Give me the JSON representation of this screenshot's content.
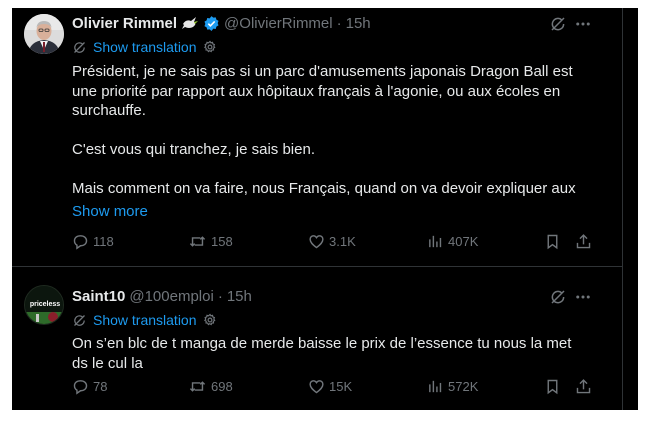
{
  "colors": {
    "background": "#000000",
    "text": "#e7e9ea",
    "muted": "#71767b",
    "link": "#1d9bf0",
    "verified": "#1d9bf0"
  },
  "tweets": [
    {
      "name": "Olivier Rimmel",
      "handle": "@OlivierRimmel",
      "dot": "·",
      "time": "15h",
      "verified": true,
      "translate_label": "Show translation",
      "lines": [
        "Président, je ne sais pas si un parc d'amusements japonais Dragon Ball est",
        "une priorité par rapport aux hôpitaux français à l'agonie, ou aux écoles en",
        "surchauffe.",
        "",
        "C'est vous qui tranchez, je sais bien.",
        "",
        "Mais comment on va faire, nous Français, quand on va devoir expliquer aux"
      ],
      "show_more": "Show more",
      "stats": {
        "replies": "118",
        "reposts": "158",
        "likes": "3.1K",
        "views": "407K"
      }
    },
    {
      "name": "Saint10",
      "handle": "@100emploi",
      "dot": "·",
      "time": "15h",
      "avatar_text": "priceless",
      "translate_label": "Show translation",
      "lines": [
        "On s’en blc de t manga de merde baisse le prix de l’essence tu nous la met",
        "ds le cul la"
      ],
      "stats": {
        "replies": "78",
        "reposts": "698",
        "likes": "15K",
        "views": "572K"
      }
    }
  ]
}
